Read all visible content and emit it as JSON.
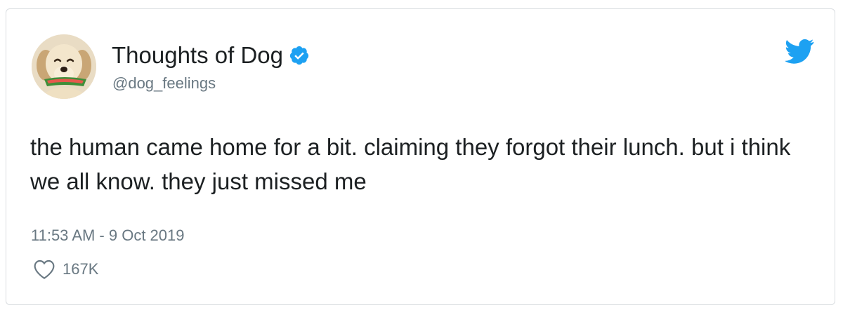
{
  "tweet": {
    "author": {
      "display_name": "Thoughts of Dog",
      "handle": "@dog_feelings",
      "verified": true
    },
    "text": "the human came home for a bit. claiming they forgot their lunch. but i think we all know. they just missed me",
    "timestamp": "11:53 AM - 9 Oct 2019",
    "likes": "167K"
  },
  "icons": {
    "verified": "verified-badge-icon",
    "brand": "twitter-bird-icon",
    "like": "heart-icon"
  },
  "colors": {
    "text_primary": "#1c2022",
    "text_secondary": "#697882",
    "brand_blue": "#1da1f2",
    "border": "#d9dde0"
  }
}
